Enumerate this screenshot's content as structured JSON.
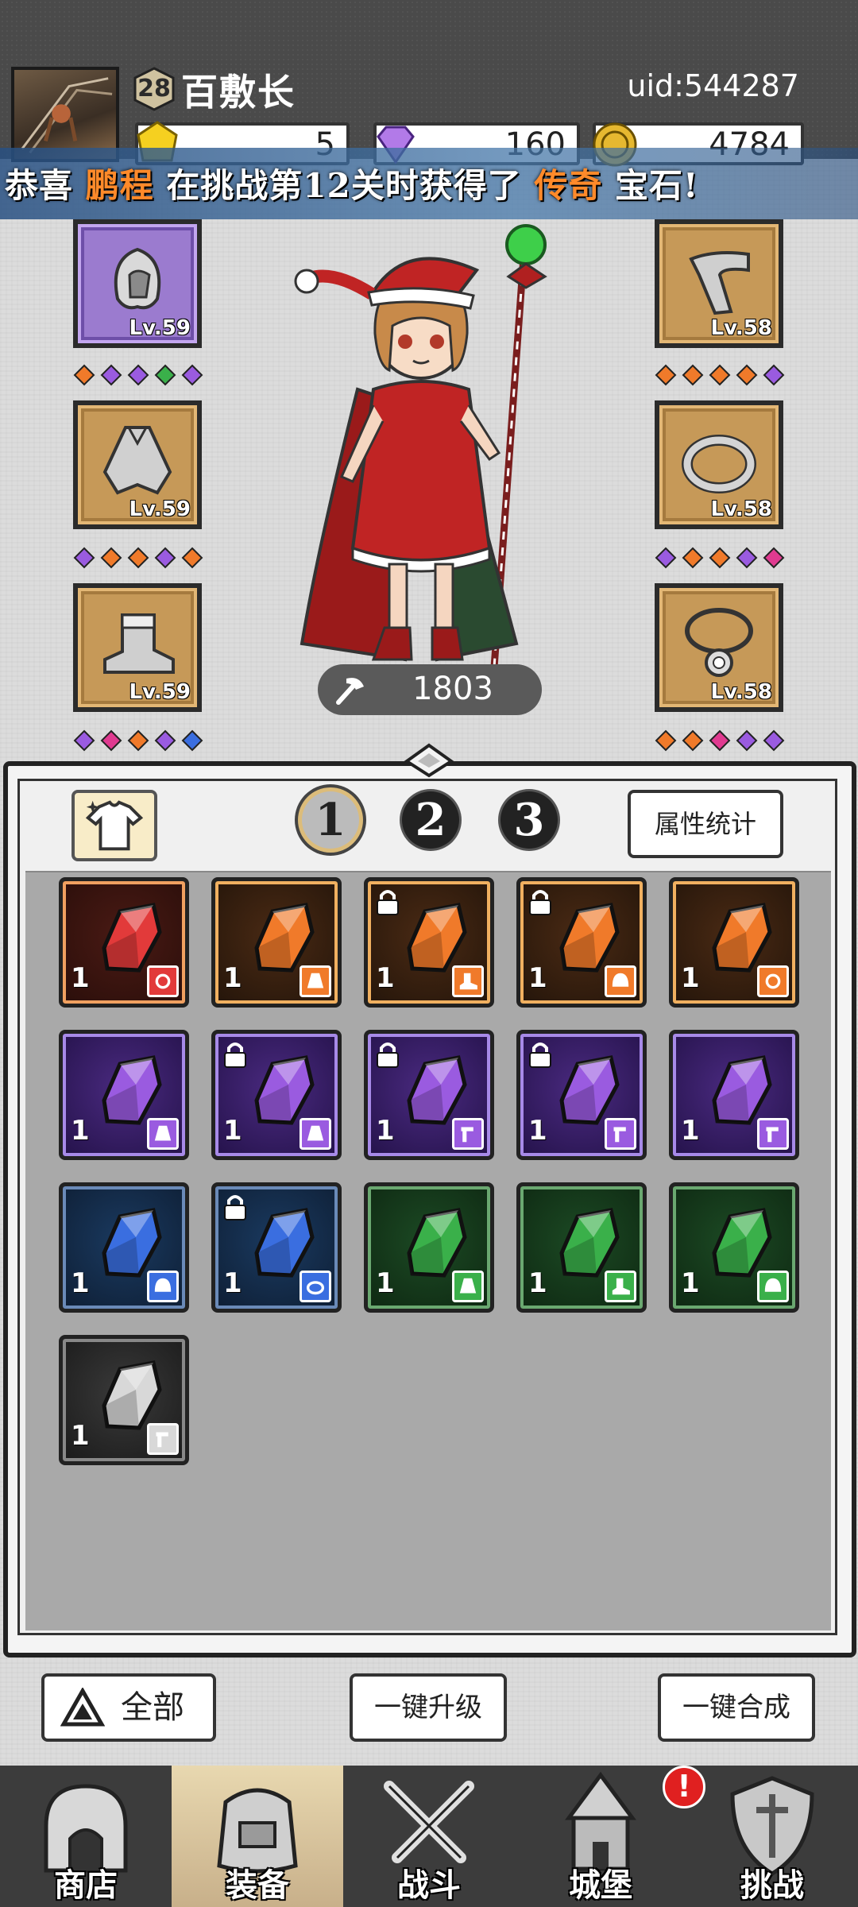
{
  "header": {
    "level": "28",
    "player_name": "百敷长",
    "uid": "uid:544287",
    "resources": [
      {
        "name": "yellow-gem",
        "value": "5"
      },
      {
        "name": "purple-gem",
        "value": "160"
      },
      {
        "name": "gold-coin",
        "value": "4784"
      }
    ]
  },
  "marquee": {
    "prefix": "恭喜 ",
    "player": "鹏程",
    "middle": " 在挑战第12关时获得了 ",
    "rarity": "传奇",
    "suffix": " 宝石!"
  },
  "equipment": {
    "left": [
      {
        "slot": "helmet",
        "level": "Lv.59",
        "gems": [
          "orange",
          "purple",
          "purple",
          "green",
          "purple"
        ]
      },
      {
        "slot": "cape",
        "level": "Lv.59",
        "gems": [
          "purple",
          "orange",
          "orange",
          "purple",
          "orange"
        ]
      },
      {
        "slot": "boots",
        "level": "Lv.59",
        "gems": [
          "purple",
          "pink",
          "orange",
          "purple",
          "blue"
        ]
      }
    ],
    "right": [
      {
        "slot": "bracer",
        "level": "Lv.58",
        "gems": [
          "orange",
          "orange",
          "orange",
          "orange",
          "purple"
        ]
      },
      {
        "slot": "ring",
        "level": "Lv.58",
        "gems": [
          "purple",
          "orange",
          "orange",
          "purple",
          "pink"
        ]
      },
      {
        "slot": "necklace",
        "level": "Lv.58",
        "gems": [
          "orange",
          "orange",
          "pink",
          "purple",
          "purple"
        ]
      }
    ]
  },
  "power": "1803",
  "bag": {
    "pages": [
      "1",
      "2",
      "3"
    ],
    "active_page": "1",
    "stats_button": "属性统计",
    "gems": [
      {
        "color": "red",
        "count": "1",
        "locked": false,
        "type": "necklace"
      },
      {
        "color": "orange",
        "count": "1",
        "locked": false,
        "type": "cape"
      },
      {
        "color": "orange",
        "count": "1",
        "locked": true,
        "type": "boots"
      },
      {
        "color": "orange",
        "count": "1",
        "locked": true,
        "type": "helmet"
      },
      {
        "color": "orange",
        "count": "1",
        "locked": false,
        "type": "necklace"
      },
      {
        "color": "purple",
        "count": "1",
        "locked": false,
        "type": "cape"
      },
      {
        "color": "purple",
        "count": "1",
        "locked": true,
        "type": "cape"
      },
      {
        "color": "purple",
        "count": "1",
        "locked": true,
        "type": "weapon"
      },
      {
        "color": "purple",
        "count": "1",
        "locked": true,
        "type": "weapon"
      },
      {
        "color": "purple",
        "count": "1",
        "locked": false,
        "type": "weapon"
      },
      {
        "color": "blue",
        "count": "1",
        "locked": false,
        "type": "helmet"
      },
      {
        "color": "blue",
        "count": "1",
        "locked": true,
        "type": "ring"
      },
      {
        "color": "green",
        "count": "1",
        "locked": false,
        "type": "cape"
      },
      {
        "color": "green",
        "count": "1",
        "locked": false,
        "type": "boots"
      },
      {
        "color": "green",
        "count": "1",
        "locked": false,
        "type": "helmet"
      },
      {
        "color": "white",
        "count": "1",
        "locked": false,
        "type": "weapon"
      }
    ]
  },
  "actions": {
    "all": "全部",
    "upgrade": "一键升级",
    "merge": "一键合成"
  },
  "nav": {
    "items": [
      {
        "label": "商店",
        "icon": "shop-icon"
      },
      {
        "label": "装备",
        "icon": "bag-icon"
      },
      {
        "label": "战斗",
        "icon": "crossed-swords-icon"
      },
      {
        "label": "城堡",
        "icon": "castle-icon"
      },
      {
        "label": "挑战",
        "icon": "challenge-shield-icon"
      }
    ],
    "active": "装备",
    "alert": "!"
  },
  "colors": {
    "red": "#e23a3a",
    "orange": "#f07a2a",
    "purple": "#9a5be0",
    "blue": "#3a6ee0",
    "green": "#3ab04a",
    "white": "#d8d8d8",
    "pink": "#e03a90",
    "highlight": "#ff8a2a"
  }
}
